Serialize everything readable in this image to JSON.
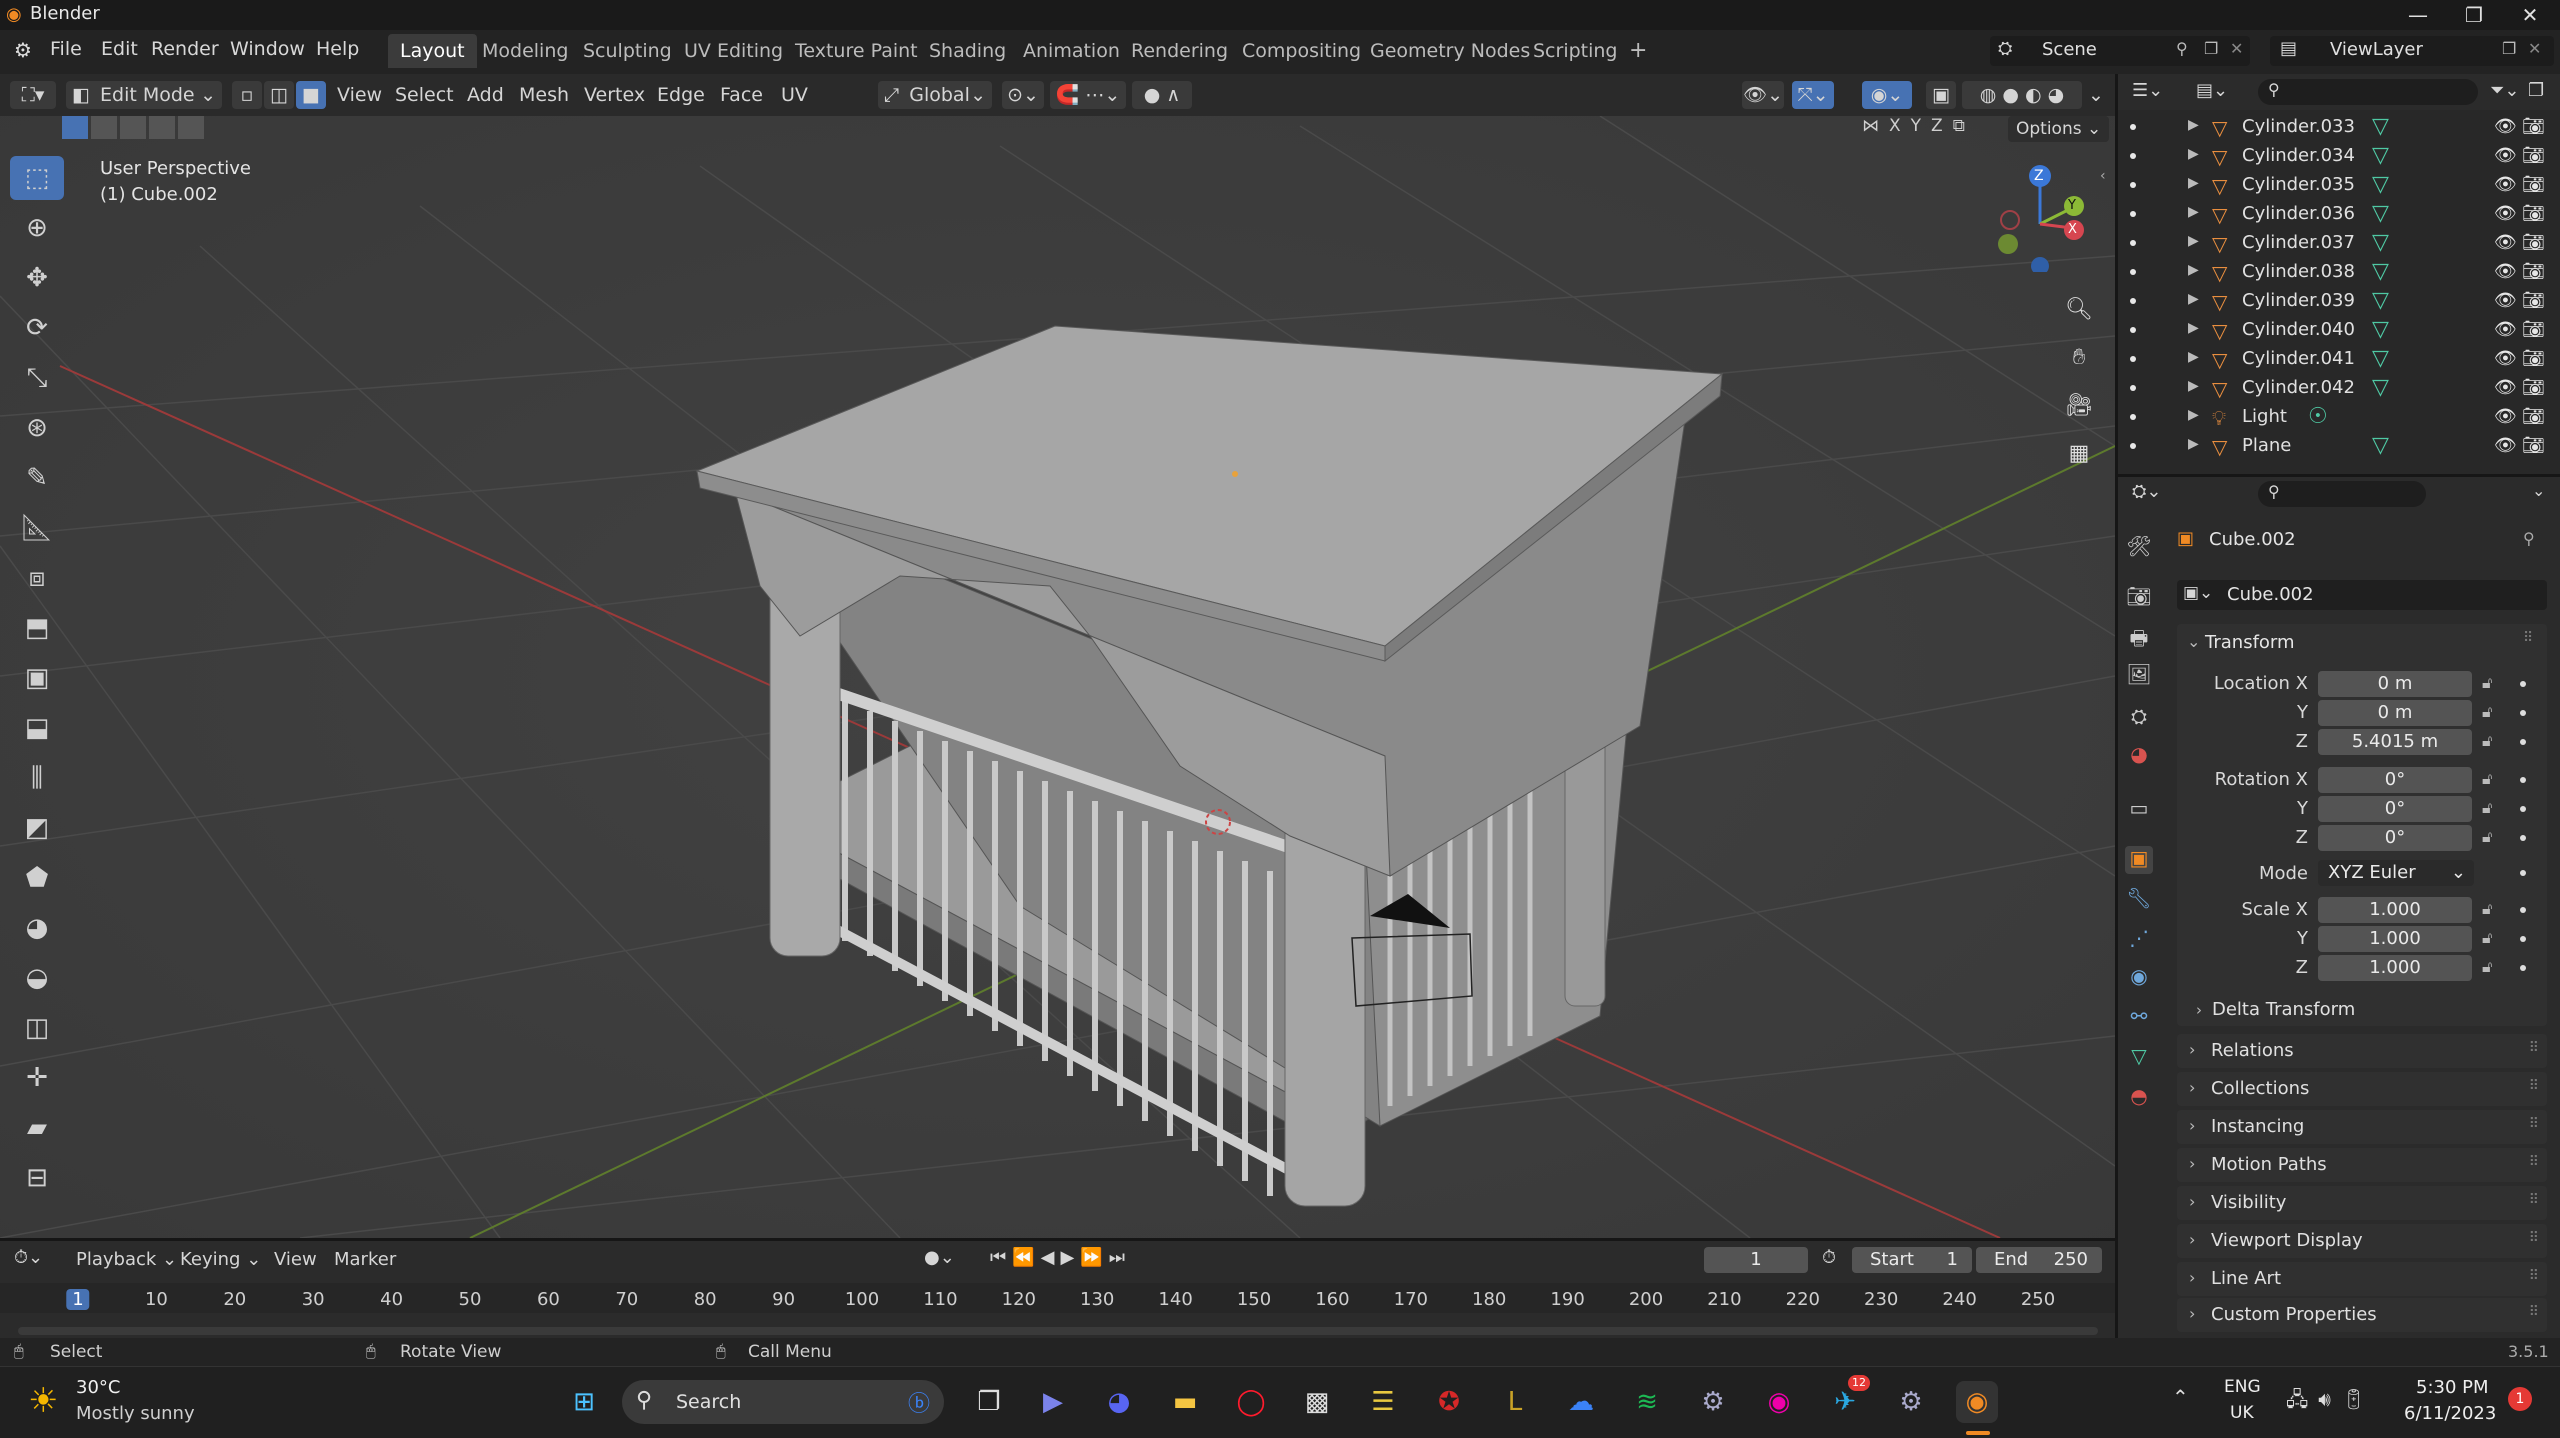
{
  "window": {
    "title": "Blender"
  },
  "menu": [
    "File",
    "Edit",
    "Render",
    "Window",
    "Help"
  ],
  "workspaces": [
    "Layout",
    "Modeling",
    "Sculpting",
    "UV Editing",
    "Texture Paint",
    "Shading",
    "Animation",
    "Rendering",
    "Compositing",
    "Geometry Nodes",
    "Scripting"
  ],
  "active_workspace": "Layout",
  "scene": {
    "name": "Scene",
    "view_layer": "ViewLayer"
  },
  "viewport_header": {
    "mode": "Edit Mode",
    "menus": [
      "View",
      "Select",
      "Add",
      "Mesh",
      "Vertex",
      "Edge",
      "Face",
      "UV"
    ],
    "transform_orientation": "Global",
    "options_label": "Options",
    "axes": [
      "X",
      "Y",
      "Z"
    ]
  },
  "viewport": {
    "view_name": "User Perspective",
    "object_info": "(1) Cube.002",
    "gizmo_axes": [
      "Z",
      "Y",
      "X"
    ]
  },
  "outliner": {
    "items": [
      {
        "name": "Cylinder.033",
        "type": "mesh"
      },
      {
        "name": "Cylinder.034",
        "type": "mesh"
      },
      {
        "name": "Cylinder.035",
        "type": "mesh"
      },
      {
        "name": "Cylinder.036",
        "type": "mesh"
      },
      {
        "name": "Cylinder.037",
        "type": "mesh"
      },
      {
        "name": "Cylinder.038",
        "type": "mesh"
      },
      {
        "name": "Cylinder.039",
        "type": "mesh"
      },
      {
        "name": "Cylinder.040",
        "type": "mesh"
      },
      {
        "name": "Cylinder.041",
        "type": "mesh"
      },
      {
        "name": "Cylinder.042",
        "type": "mesh"
      },
      {
        "name": "Light",
        "type": "light"
      },
      {
        "name": "Plane",
        "type": "mesh"
      }
    ]
  },
  "properties": {
    "object_name": "Cube.002",
    "datablock": "Cube.002",
    "transform_label": "Transform",
    "location": {
      "label": "Location X",
      "x": "0 m",
      "y": "0 m",
      "z": "5.4015 m"
    },
    "rotation": {
      "label": "Rotation X",
      "x": "0°",
      "y": "0°",
      "z": "0°"
    },
    "mode": {
      "label": "Mode",
      "value": "XYZ Euler"
    },
    "scale": {
      "label": "Scale X",
      "x": "1.000",
      "y": "1.000",
      "z": "1.000"
    },
    "axis_y": "Y",
    "axis_z": "Z",
    "delta": "Delta Transform",
    "sections": [
      "Relations",
      "Collections",
      "Instancing",
      "Motion Paths",
      "Visibility",
      "Viewport Display",
      "Line Art",
      "Custom Properties"
    ]
  },
  "timeline": {
    "menus": [
      "Playback",
      "Keying",
      "View",
      "Marker"
    ],
    "current_frame": "1",
    "start_label": "Start",
    "start": "1",
    "end_label": "End",
    "end": "250",
    "ticks": [
      "1",
      "10",
      "20",
      "30",
      "40",
      "50",
      "60",
      "70",
      "80",
      "90",
      "100",
      "110",
      "120",
      "130",
      "140",
      "150",
      "160",
      "170",
      "180",
      "190",
      "200",
      "210",
      "220",
      "230",
      "240",
      "250"
    ]
  },
  "statusbar": {
    "select": "Select",
    "rotate": "Rotate View",
    "menu": "Call Menu",
    "version": "3.5.1"
  },
  "taskbar": {
    "weather_temp": "30°C",
    "weather_desc": "Mostly sunny",
    "search": "Search",
    "lang1": "ENG",
    "lang2": "UK",
    "time": "5:30 PM",
    "date": "6/11/2023",
    "notif_count": "1",
    "telegram_badge": "12"
  },
  "colors": {
    "accent": "#4772b3",
    "mesh_icon": "#e98e3f",
    "data_icon": "#4fc9a4"
  }
}
